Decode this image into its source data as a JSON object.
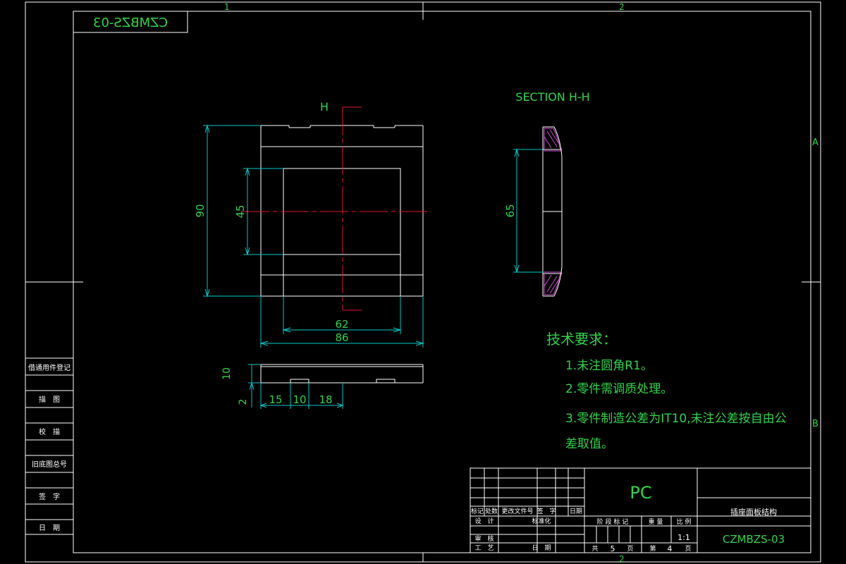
{
  "colors": {
    "background": "#000000",
    "line": "#ffffff",
    "dimension": "#00c8c8",
    "center_line": "#e0182a",
    "text": "#2fd54a",
    "hatch": "#d050d0"
  },
  "zone_markers": {
    "top": [
      "1",
      "2"
    ],
    "bottom": [
      "2"
    ],
    "right": [
      "A",
      "B"
    ]
  },
  "mirrored_code": "CZMBZS-03",
  "section_marker": "H",
  "section_title": "SECTION H-H",
  "dimensions": {
    "front_height": "90",
    "window_height": "45",
    "window_width": "62",
    "overall_width": "86",
    "section_height": "65",
    "side_thickness": "10",
    "side_step": "2",
    "seg_1": "15",
    "seg_2": "10",
    "seg_3": "18"
  },
  "tech_requirements": {
    "heading": "技术要求：",
    "items": [
      "1.未注圆角R1。",
      "2.零件需调质处理。",
      "3.零件制造公差为IT10,未注公差按自由公",
      "差取值。"
    ]
  },
  "left_strip": {
    "items": [
      "借通用件登记",
      "描　图",
      "校　描",
      "旧底图总号",
      "签　字",
      "日　期"
    ]
  },
  "title_block": {
    "material": "PC",
    "part_name": "插座面板结构",
    "drawing_number": "CZMBZS-03",
    "scale": "1:1",
    "sheet_total": "5",
    "sheet_number": "4",
    "labels": {
      "mark": "标记",
      "count": "处数",
      "change_doc": "更改文件号",
      "signature": "签　字",
      "date": "日期",
      "design": "设　计",
      "standardization": "标准化",
      "review": "审　核",
      "process": "工　艺",
      "date2": "日　期",
      "stage_mark": "阶 段 标 记",
      "weight": "重 量",
      "scale": "比 例",
      "total": "共",
      "sheets": "页",
      "page_no": "第"
    }
  }
}
